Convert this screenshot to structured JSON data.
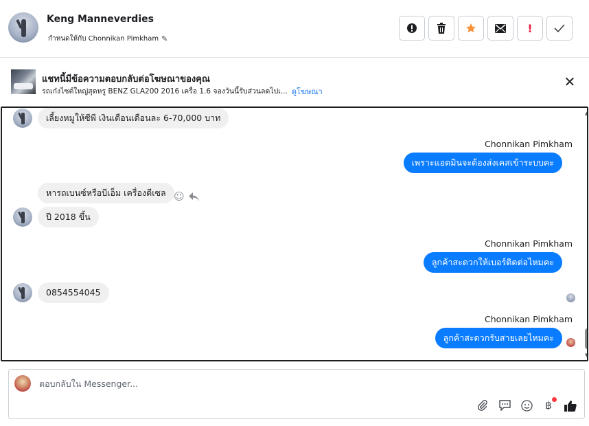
{
  "header": {
    "name": "Keng Manneverdies",
    "assigned_text": "กำหนดให้กับ Chonnikan Pimkham",
    "actions": [
      {
        "icon": "alert-circle-icon"
      },
      {
        "icon": "trash-icon"
      },
      {
        "icon": "star-icon",
        "color": "#f7923b"
      },
      {
        "icon": "mail-icon"
      },
      {
        "icon": "exclamation-icon",
        "color": "#e41e3f"
      },
      {
        "icon": "check-icon"
      }
    ]
  },
  "ad": {
    "title": "แชทนี้มีข้อความตอบกลับต่อโฆษณาของคุณ",
    "subtitle": "รถเก๋งไซต์ใหญ่สุดหรู BENZ GLA200 2016 เครื่อ 1.6 จองวันนี้รับส่วนลดไปเ...",
    "link": "ดูโฆษณา"
  },
  "messages": [
    {
      "dir": "in",
      "text": "เลี้ยงหมูให้ซีพี เงินเดือนเดือนละ 6-70,000 บาท"
    },
    {
      "dir": "out",
      "sender": "Chonnikan Pimkham",
      "text": "เพราะแอดมินจะต้องส่งเคสเข้าระบบคะ"
    },
    {
      "dir": "in",
      "text": "หารถเบนซ์หรือบีเอ็ม เครื่องดีเซล"
    },
    {
      "dir": "in",
      "text": "ปี 2018 ขึ้น"
    },
    {
      "dir": "out",
      "sender": "Chonnikan Pimkham",
      "text": "ลูกค้าสะดวกให้เบอร์ติดต่อไหมคะ"
    },
    {
      "dir": "in",
      "text": "0854554045"
    },
    {
      "dir": "out",
      "sender": "Chonnikan Pimkham",
      "text": "ลูกค้าสะดวกรับสายเลยไหมคะ"
    }
  ],
  "composer": {
    "placeholder": "ตอบกลับใน Messenger..."
  },
  "colors": {
    "outgoing_bubble": "#0a7cff",
    "incoming_bubble": "#f0f0f0",
    "link": "#1877f2"
  }
}
